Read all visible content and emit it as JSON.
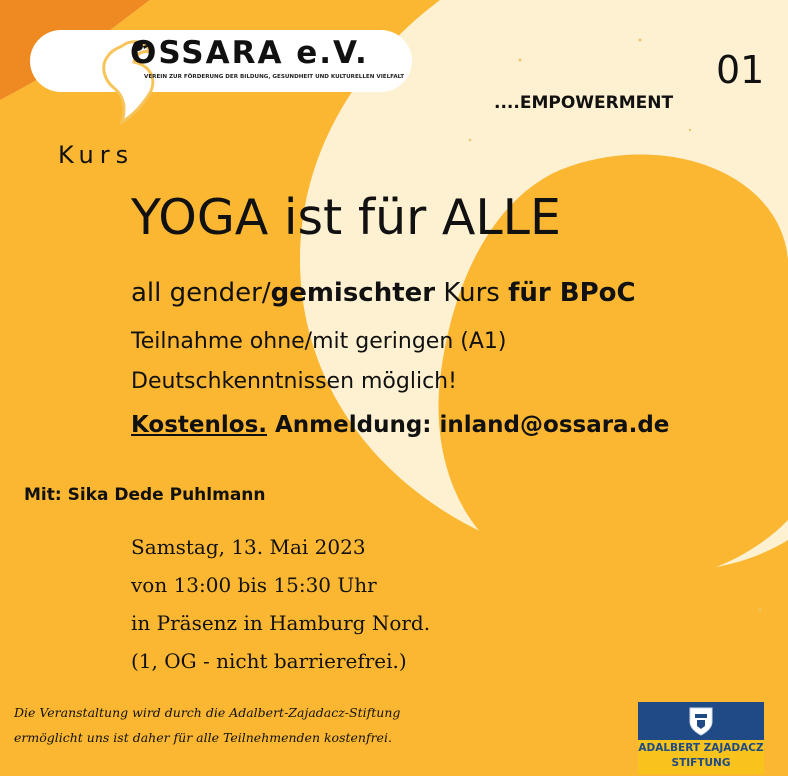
{
  "colors": {
    "background": "#fdf1d2",
    "yellow": "#fbb731",
    "orange": "#ef8a22",
    "sponsor_blue": "#1f4a86",
    "sponsor_yellow": "#f7c31c"
  },
  "logo": {
    "title": "OSSARA e.V.",
    "subtitle": "VEREIN ZUR FÖRDERUNG DER BILDUNG, GESUNDHEIT UND KULTURELLEN VIELFALT",
    "icon": "bird-icon"
  },
  "header": {
    "number": "01",
    "tagline": "....EMPOWERMENT"
  },
  "course": {
    "kurs_label": "Kurs",
    "title": "YOGA ist für ALLE",
    "line1_a": "all gender/",
    "line1_b": "gemischter",
    "line1_c": " Kurs ",
    "line1_d": "für BPoC",
    "line2": "Teilnahme ohne/mit geringen (A1)",
    "line3": "Deutschkenntnissen möglich!",
    "free": "Kostenlos.",
    "registration": " Anmeldung: inland@ossara.de"
  },
  "instructor": "Mit: Sika Dede Puhlmann",
  "details": [
    "Samstag, 13.  Mai 2023",
    "von 13:00 bis 15:30 Uhr",
    "in Präsenz in Hamburg Nord.",
    "(1, OG - nicht barrierefrei.)"
  ],
  "footer": [
    "Die Veranstaltung wird durch die Adalbert-Zajadacz-Stiftung",
    "ermöglicht uns ist daher für alle Teilnehmenden kostenfrei."
  ],
  "sponsor": {
    "line1": "ADALBERT ZAJADACZ",
    "line2": "STIFTUNG",
    "icon": "crest-icon"
  }
}
